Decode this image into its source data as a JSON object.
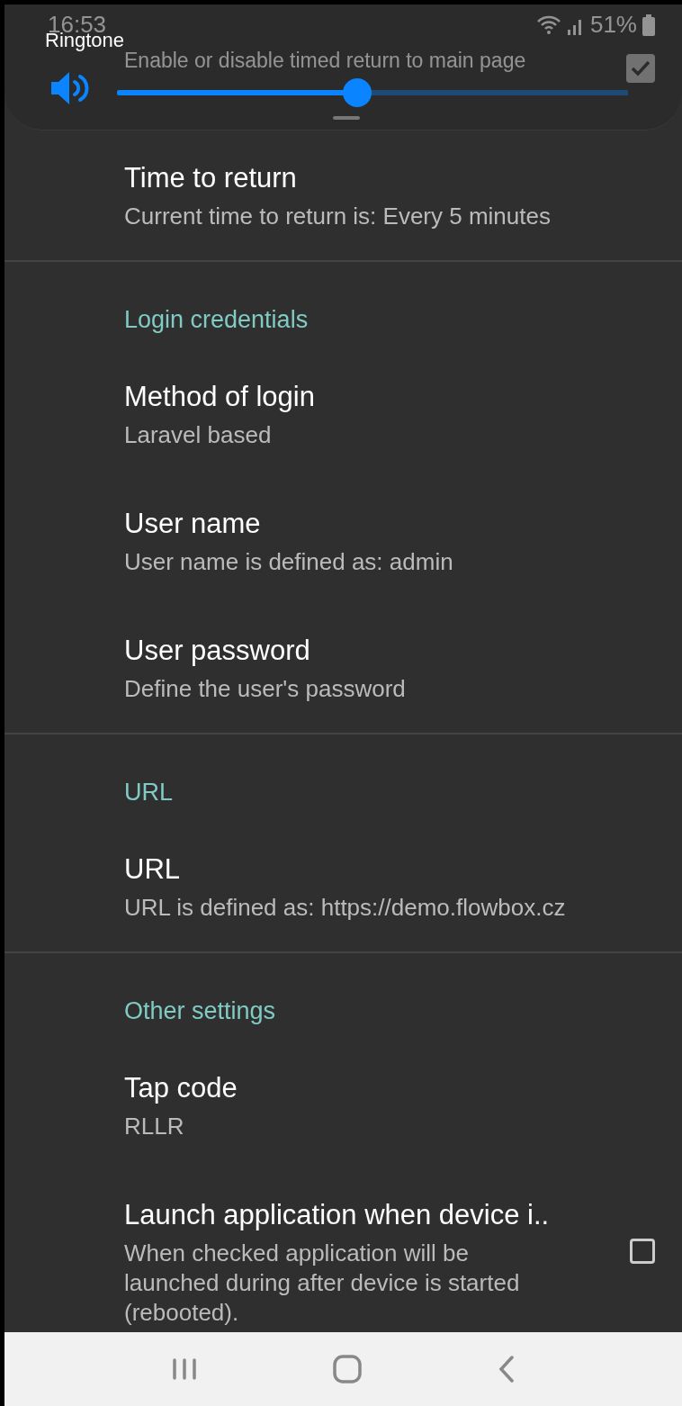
{
  "status_bar": {
    "time": "16:53",
    "battery": "51%"
  },
  "volume_panel": {
    "label": "Ringtone",
    "level": 0.47
  },
  "sections": [
    {
      "items": [
        {
          "kind": "checkbox",
          "summary": "Enable or disable timed return to main page",
          "checked": true
        },
        {
          "kind": "text",
          "title": "Time to return",
          "summary": "Current time to return is: Every 5 minutes"
        }
      ]
    },
    {
      "header": "Login credentials",
      "items": [
        {
          "kind": "text",
          "title": "Method of login",
          "summary": "Laravel based"
        },
        {
          "kind": "text",
          "title": "User name",
          "summary": "User name is defined as: admin"
        },
        {
          "kind": "text",
          "title": "User password",
          "summary": "Define the user's password"
        }
      ]
    },
    {
      "header": "URL",
      "items": [
        {
          "kind": "text",
          "title": "URL",
          "summary": "URL is defined as: https://demo.flowbox.cz"
        }
      ]
    },
    {
      "header": "Other settings",
      "items": [
        {
          "kind": "text",
          "title": "Tap code",
          "summary": "RLLR"
        },
        {
          "kind": "checkbox",
          "title": "Launch application when device i..",
          "summary": "When checked application will be launched during after device is started (rebooted).",
          "checked": false
        }
      ]
    }
  ]
}
